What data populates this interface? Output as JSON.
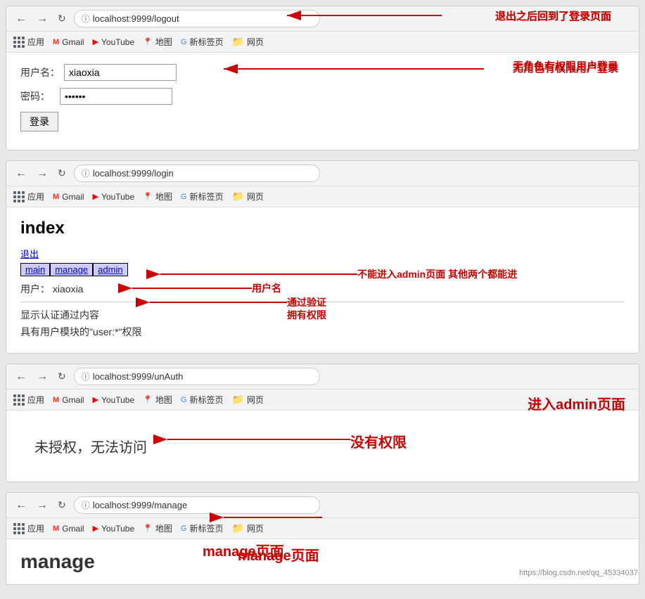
{
  "sections": {
    "logout": {
      "url": "localhost:9999/logout",
      "annotation_top": "退出之后回到了登录页面",
      "bookmarks": [
        "应用",
        "Gmail",
        "YouTube",
        "地图",
        "新标签页",
        "网页"
      ],
      "form": {
        "username_label": "用户名：",
        "username_value": "xiaoxia",
        "password_label": "密码：",
        "password_value": "••••••",
        "login_btn": "登录"
      },
      "annotation_right": "无角色有权限用户登录"
    },
    "login": {
      "url": "localhost:9999/login",
      "bookmarks": [
        "应用",
        "Gmail",
        "YouTube",
        "地图",
        "新标签页",
        "网页"
      ],
      "page_title": "index",
      "logout_link": "退出",
      "nav_links": [
        "main",
        "manage",
        "admin"
      ],
      "annotation_nav": "不能进入admin页面 其他两个都能进",
      "user_label": "用户：",
      "user_value": "xiaoxia",
      "annotation_user": "用户名",
      "auth_text": "显示认证通过内容",
      "annotation_auth": "通过验证",
      "permission_text": "具有用户模块的\"user:*\"权限",
      "annotation_perm": "拥有权限"
    },
    "unauth": {
      "url": "localhost:9999/unAuth",
      "bookmarks": [
        "应用",
        "Gmail",
        "YouTube",
        "地图",
        "新标签页",
        "网页"
      ],
      "annotation_top": "进入admin页面",
      "unauth_text": "未授权，无法访问",
      "annotation_right": "没有权限"
    },
    "manage": {
      "url": "localhost:9999/manage",
      "bookmarks": [
        "应用",
        "Gmail",
        "YouTube",
        "地图",
        "新标签页",
        "网页"
      ],
      "annotation_top": "manage页面",
      "page_title": "manage"
    }
  },
  "watermark": "https://blog.csdn.net/qq_45334037"
}
